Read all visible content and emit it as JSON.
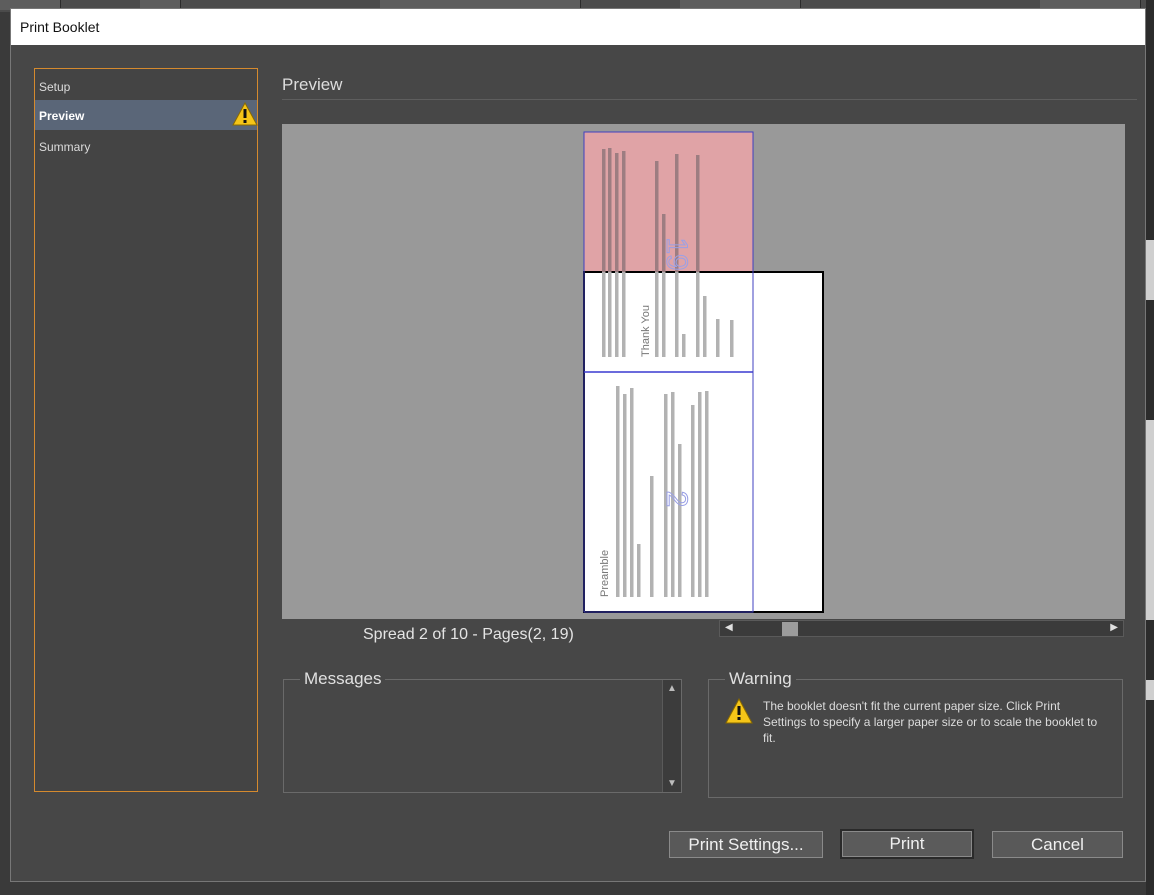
{
  "dialog": {
    "title": "Print Booklet"
  },
  "nav": {
    "items": [
      {
        "label": "Setup"
      },
      {
        "label": "Preview"
      },
      {
        "label": "Summary"
      }
    ]
  },
  "preview": {
    "heading": "Preview",
    "spread_label": "Spread 2 of 10 - Pages(2, 19)",
    "page_upper": {
      "number": "19",
      "text": "Thank You"
    },
    "page_lower": {
      "number": "2",
      "text": "Preamble"
    }
  },
  "messages": {
    "title": "Messages"
  },
  "warning": {
    "title": "Warning",
    "text": "The booklet doesn't fit the current paper size. Click Print Settings to specify a larger paper size or to scale the booklet to fit."
  },
  "buttons": {
    "print_settings": "Print Settings...",
    "print": "Print",
    "cancel": "Cancel"
  },
  "colors": {
    "accent_border": "#d58a2e",
    "active_nav": "#5a6678",
    "warning_yellow": "#f5c518",
    "overflow_area": "#e0a3a6",
    "page_outline": "#4040c0"
  }
}
